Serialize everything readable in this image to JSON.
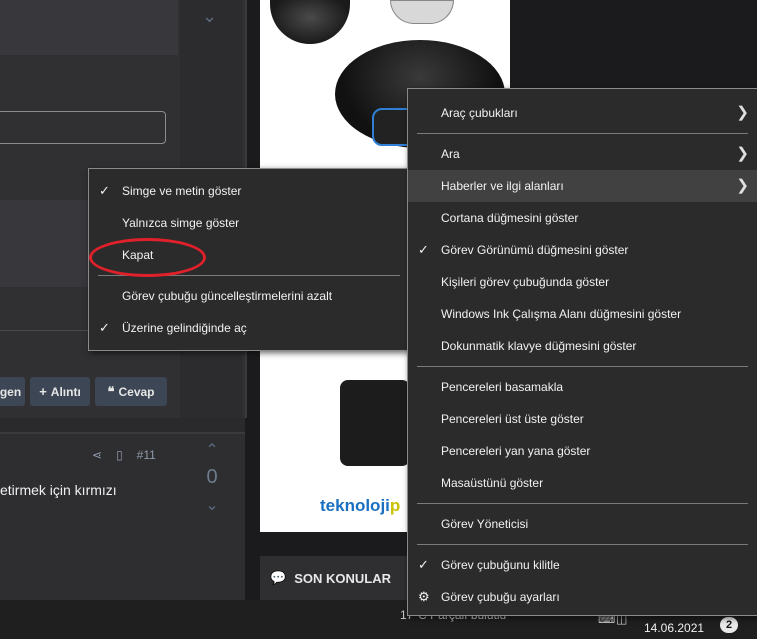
{
  "page": {
    "buttons": [
      {
        "label": "gen",
        "icon": ""
      },
      {
        "label": "Alıntı",
        "icon": "+"
      },
      {
        "label": "Cevap",
        "icon": "❝"
      }
    ],
    "post_number": "#11",
    "vote_count": "0",
    "post_text": "etirmek için kırmızı",
    "sidebar_heading": "SON KONULAR",
    "ad_brand_a": "teknoloji",
    "ad_brand_b": "p"
  },
  "taskbar": {
    "weather_text": "17°C  Parçalı bulutlu",
    "date": "14.06.2021",
    "notification_count": "2"
  },
  "submenu": {
    "items": [
      {
        "label": "Simge ve metin göster",
        "checked": true
      },
      {
        "label": "Yalnızca simge göster",
        "checked": false
      },
      {
        "label": "Kapat",
        "checked": false,
        "highlighted_by_annotation": true
      },
      {
        "label": "Görev çubuğu güncelleştirmelerini azalt",
        "checked": false
      },
      {
        "label": "Üzerine gelindiğinde aç",
        "checked": true
      }
    ]
  },
  "mainmenu": {
    "items": [
      {
        "label": "Araç çubukları",
        "has_submenu": true
      },
      {
        "label": "Ara",
        "has_submenu": true
      },
      {
        "label": "Haberler ve ilgi alanları",
        "has_submenu": true,
        "highlighted": true
      },
      {
        "label": "Cortana düğmesini göster"
      },
      {
        "label": "Görev Görünümü düğmesini göster",
        "checked": true
      },
      {
        "label": "Kişileri görev çubuğunda göster"
      },
      {
        "label": "Windows Ink Çalışma Alanı düğmesini göster"
      },
      {
        "label": "Dokunmatik klavye düğmesini göster"
      },
      {
        "label": "Pencereleri basamakla"
      },
      {
        "label": "Pencereleri üst üste göster"
      },
      {
        "label": "Pencereleri yan yana göster"
      },
      {
        "label": "Masaüstünü göster"
      },
      {
        "label": "Görev Yöneticisi"
      },
      {
        "label": "Görev çubuğunu kilitle",
        "checked": true
      },
      {
        "label": "Görev çubuğu ayarları",
        "icon": "gear-icon"
      }
    ]
  },
  "colors": {
    "menu_bg": "#2b2b2b",
    "menu_highlight": "#414141",
    "annotation_circle": "#e0202a"
  }
}
